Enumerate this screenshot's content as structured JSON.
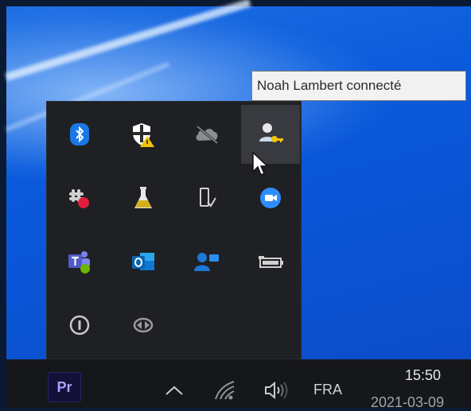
{
  "tooltip": {
    "text": "Noah Lambert connecté"
  },
  "tray": {
    "icons": [
      "bluetooth-icon",
      "windows-security-warning-icon",
      "onedrive-offline-icon",
      "user-key-icon",
      "slack-icon",
      "flask-icon",
      "device-icon",
      "zoom-icon",
      "teams-icon",
      "outlook-icon",
      "people-icon",
      "battery-icon",
      "info-icon",
      "sync-icon"
    ]
  },
  "taskbar": {
    "app_label": "Pr",
    "language": "FRA",
    "time": "15:50",
    "date": "2021-03-09"
  },
  "colors": {
    "accent": "#1e6fe6",
    "taskbar": "#16171b",
    "flyout": "#1f2024"
  }
}
